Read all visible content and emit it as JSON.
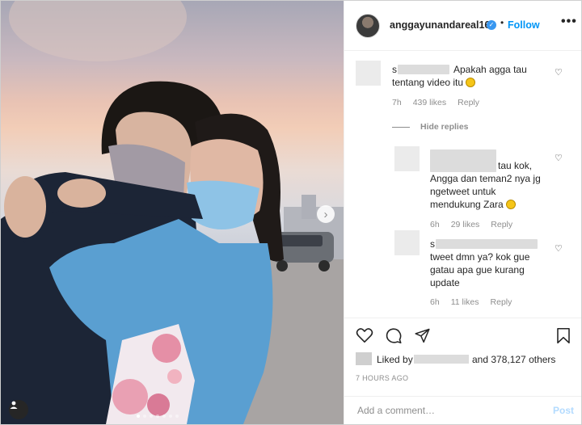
{
  "post": {
    "username": "anggayunandareal16",
    "verified_mark": "✓",
    "separator": "•",
    "follow_label": "Follow",
    "more_label": "•••"
  },
  "photo": {
    "next_glyph": "›",
    "carousel": {
      "count": 7,
      "active_index": 0
    }
  },
  "comments": [
    {
      "name_prefix": "s",
      "text": "Apakah agga tau tentang video itu",
      "emoji": "grin",
      "time": "7h",
      "likes": "439 likes",
      "reply": "Reply"
    }
  ],
  "hide_replies_label": "Hide replies",
  "replies": [
    {
      "text_line1": "tau kok,",
      "text_rest": "Angga dan teman2 nya jg ngetweet untuk mendukung Zara",
      "emoji": "smile",
      "time": "6h",
      "likes": "29 likes",
      "reply": "Reply"
    },
    {
      "name_prefix": "s",
      "text": "tweet dmn ya? kok gue gatau apa gue kurang update",
      "time": "6h",
      "likes": "11 likes",
      "reply": "Reply"
    }
  ],
  "actions": {
    "icons": [
      "heart-icon",
      "comment-icon",
      "share-icon",
      "bookmark-icon"
    ]
  },
  "likes": {
    "liked_by": "Liked by",
    "and_others": "and 378,127 others"
  },
  "timestamp": "7 HOURS AGO",
  "add_comment": {
    "placeholder": "Add a comment…",
    "post_label": "Post"
  },
  "colors": {
    "link_blue": "#0095f6",
    "verified_blue": "#3897f0",
    "muted": "#8e8e8e",
    "post_disabled": "#b3dbff"
  }
}
